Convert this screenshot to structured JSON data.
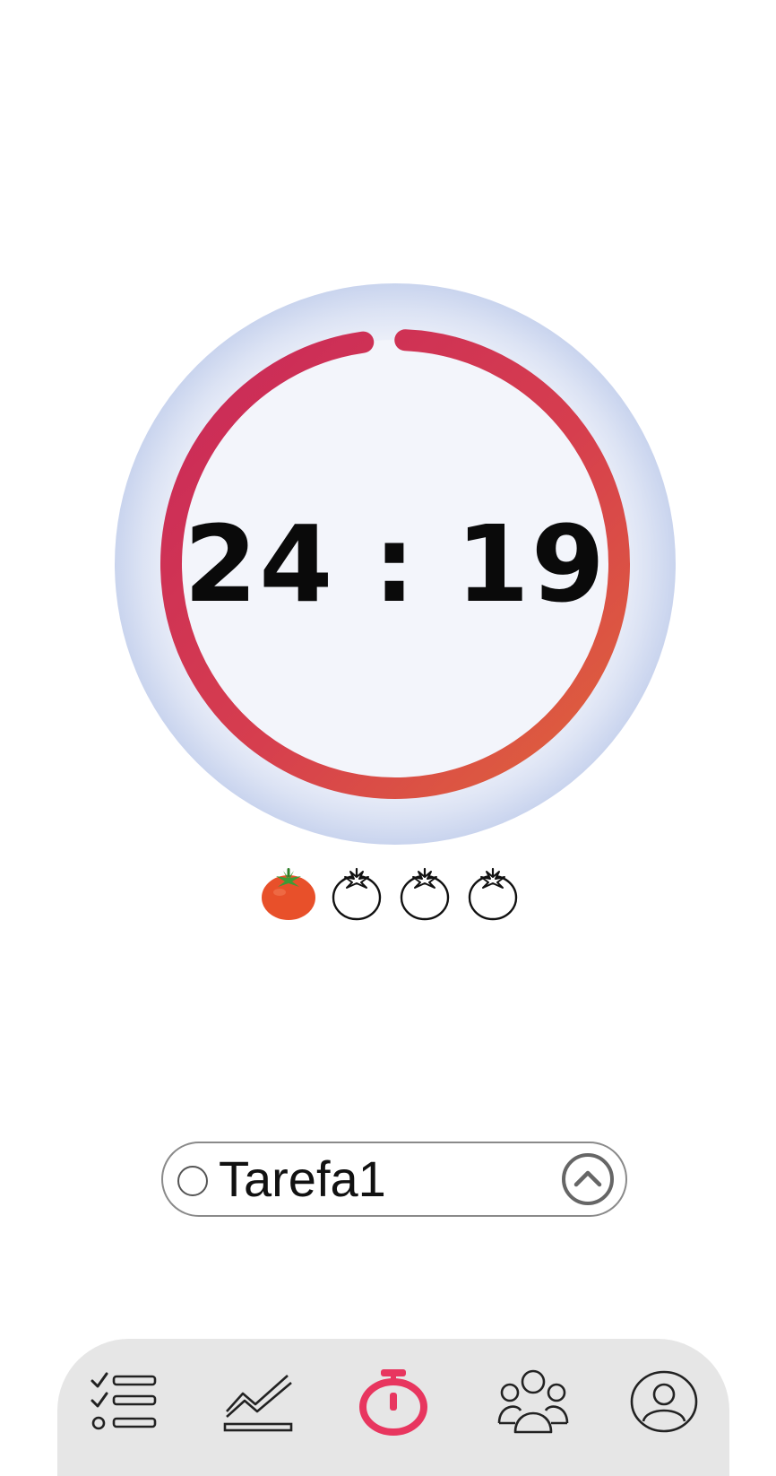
{
  "timer": {
    "display": "24 : 19",
    "progress_fraction": 0.97
  },
  "pomodoros": {
    "completed": 1,
    "total": 4
  },
  "task": {
    "label": "Tarefa1"
  },
  "nav": {
    "items": [
      {
        "icon": "task-list-icon",
        "active": false
      },
      {
        "icon": "statistics-chart-icon",
        "active": false
      },
      {
        "icon": "stopwatch-icon",
        "active": true
      },
      {
        "icon": "group-icon",
        "active": false
      },
      {
        "icon": "profile-icon",
        "active": false
      }
    ]
  },
  "colors": {
    "accent": "#e8365f",
    "ring_start": "#c9285a",
    "ring_end": "#e0653a",
    "tomato": "#e8502a",
    "tomato_leaf": "#3d9b35",
    "nav_bg": "#e6e6e6"
  }
}
